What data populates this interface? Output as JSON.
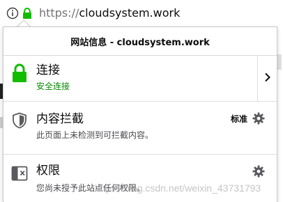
{
  "urlbar": {
    "scheme": "https://",
    "host": "cloudsystem.work",
    "info_icon": "info-icon",
    "lock_icon": "lock-icon"
  },
  "panel": {
    "title": "网站信息 - cloudsystem.work",
    "connection": {
      "title": "连接",
      "status": "安全连接",
      "icon": "lock-icon",
      "more_icon": "chevron-right-icon"
    },
    "content_blocking": {
      "title": "内容拦截",
      "description": "此页面上未检测到可拦截内容。",
      "mode_label": "标准",
      "icon": "shield-icon",
      "settings_icon": "gear-icon"
    },
    "permissions": {
      "title": "权限",
      "description": "您尚未授予此站点任何权限。",
      "icon": "permissions-icon",
      "settings_icon": "gear-icon"
    }
  },
  "watermark": "https://blog.csdn.net/weixin_43731793",
  "colors": {
    "secure_green": "#12bc00",
    "secure_text": "#058b00",
    "icon_gray": "#5a5a5f"
  }
}
